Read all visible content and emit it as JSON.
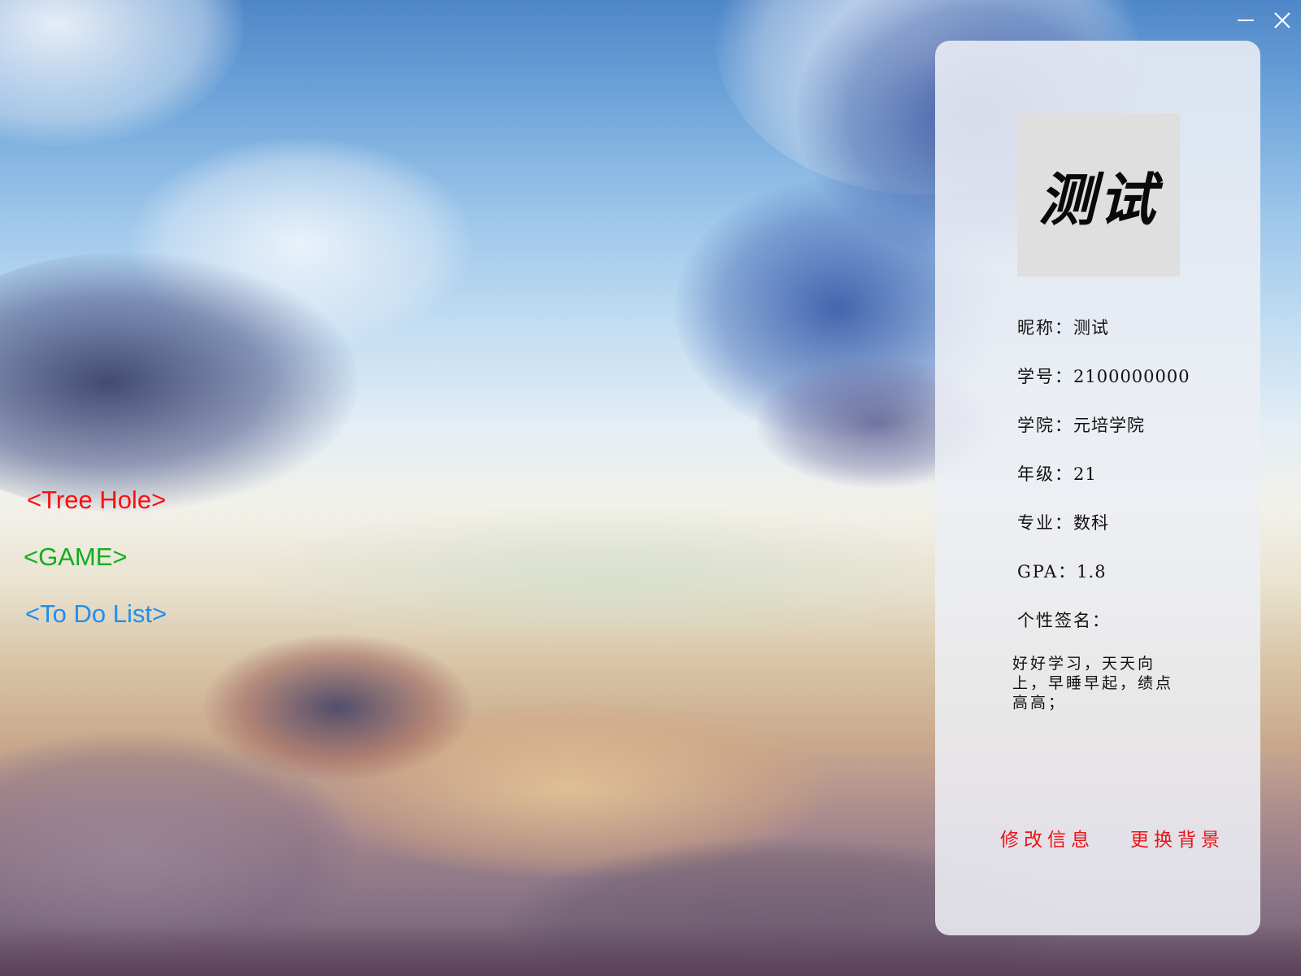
{
  "window": {
    "minimize_icon": "minimize-icon",
    "close_icon": "close-icon"
  },
  "nav": {
    "tree_hole": "<Tree Hole>",
    "game": "<GAME>",
    "todo": "<To Do List>",
    "colors": {
      "tree_hole": "#ff0d0d",
      "game": "#0fae1f",
      "todo": "#1e8ff0"
    }
  },
  "profile": {
    "avatar_text": "测试",
    "nickname_label": "昵称：",
    "nickname": "测试",
    "student_id_label": "学号：",
    "student_id": "2100000000",
    "college_label": "学院：",
    "college": "元培学院",
    "grade_label": "年级：",
    "grade": "21",
    "major_label": "专业：",
    "major": "数科",
    "gpa_label": "GPA：",
    "gpa": "1.8",
    "signature_label": "个性签名：",
    "signature": "好好学习，天天向上，早睡早起，绩点高高；",
    "edit_button": "修改信息",
    "change_bg_button": "更换背景",
    "button_color": "#e8141a"
  }
}
